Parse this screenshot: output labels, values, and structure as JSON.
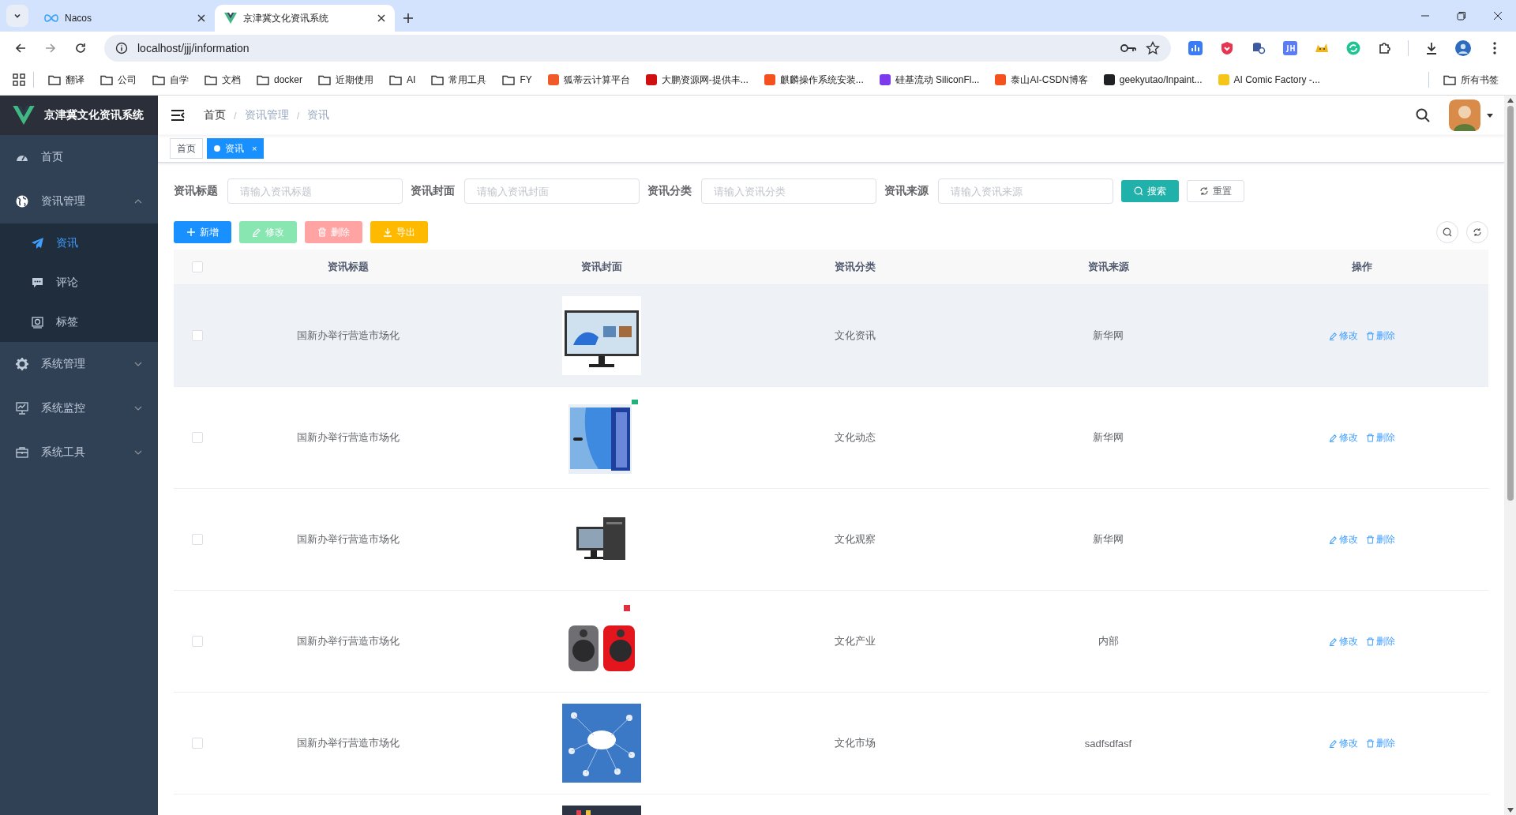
{
  "browser": {
    "tabs": [
      {
        "title": "Nacos",
        "selected": false
      },
      {
        "title": "京津冀文化资讯系统",
        "selected": true
      }
    ],
    "address": "localhost/jjj/information",
    "bookmarks": [
      {
        "label": "翻译",
        "kind": "folder"
      },
      {
        "label": "公司",
        "kind": "folder"
      },
      {
        "label": "自学",
        "kind": "folder"
      },
      {
        "label": "文档",
        "kind": "folder"
      },
      {
        "label": "docker",
        "kind": "folder"
      },
      {
        "label": "近期使用",
        "kind": "folder"
      },
      {
        "label": "AI",
        "kind": "folder"
      },
      {
        "label": "常用工具",
        "kind": "folder"
      },
      {
        "label": "FY",
        "kind": "folder"
      },
      {
        "label": "狐蒂云计算平台",
        "kind": "site",
        "color": "#f05a28"
      },
      {
        "label": "大鹏资源网-提供丰...",
        "kind": "site",
        "color": "#d01010"
      },
      {
        "label": "麒麟操作系统安装...",
        "kind": "site",
        "color": "#f4511e"
      },
      {
        "label": "硅基流动 SiliconFl...",
        "kind": "site",
        "color": "#7c3aed"
      },
      {
        "label": "泰山AI-CSDN博客",
        "kind": "site",
        "color": "#f4511e"
      },
      {
        "label": "geekyutao/Inpaint...",
        "kind": "site",
        "color": "#202124"
      },
      {
        "label": "AI Comic Factory -...",
        "kind": "site",
        "color": "#f5c518"
      }
    ],
    "all_bookmarks": "所有书签"
  },
  "sidebar": {
    "title": "京津冀文化资讯系统",
    "items": [
      {
        "label": "首页",
        "selected": false
      },
      {
        "label": "资讯管理",
        "selected": false,
        "expanded": true,
        "children": [
          {
            "label": "资讯",
            "selected": true
          },
          {
            "label": "评论",
            "selected": false
          },
          {
            "label": "标签",
            "selected": false
          }
        ]
      },
      {
        "label": "系统管理",
        "selected": false,
        "expanded": false
      },
      {
        "label": "系统监控",
        "selected": false,
        "expanded": false
      },
      {
        "label": "系统工具",
        "selected": false,
        "expanded": false
      }
    ]
  },
  "breadcrumb": [
    {
      "label": "首页"
    },
    {
      "label": "资讯管理",
      "separator": "/"
    },
    {
      "label": "资讯",
      "separator": "/"
    }
  ],
  "tags": [
    {
      "label": "首页",
      "selected": false
    },
    {
      "label": "资讯",
      "selected": true,
      "close": "×"
    }
  ],
  "filters": [
    {
      "label": "资讯标题",
      "placeholder": "请输入资讯标题"
    },
    {
      "label": "资讯封面",
      "placeholder": "请输入资讯封面"
    },
    {
      "label": "资讯分类",
      "placeholder": "请输入资讯分类"
    },
    {
      "label": "资讯来源",
      "placeholder": "请输入资讯来源"
    }
  ],
  "search_button": "搜索",
  "reset_button": "重置",
  "toolbar": [
    {
      "label": "新增",
      "kind": "add",
      "disabled": false
    },
    {
      "label": "修改",
      "kind": "edit",
      "disabled": true
    },
    {
      "label": "删除",
      "kind": "delete",
      "disabled": true
    },
    {
      "label": "导出",
      "kind": "export",
      "disabled": false
    }
  ],
  "table": {
    "header_checked": false,
    "columns": [
      "资讯标题",
      "资讯封面",
      "资讯分类",
      "资讯来源",
      "操作"
    ],
    "rows": [
      {
        "checked": false,
        "highlighted": true,
        "title": "国新办举行营造市场化",
        "cover": {
          "kind": "picture"
        },
        "category": "文化资讯",
        "source": "新华网",
        "actions": [
          "修改",
          "删除"
        ]
      },
      {
        "checked": false,
        "highlighted": false,
        "title": "国新办举行营造市场化",
        "cover": {
          "kind": "picture"
        },
        "category": "文化动态",
        "source": "新华网",
        "actions": [
          "修改",
          "删除"
        ]
      },
      {
        "checked": false,
        "highlighted": false,
        "title": "国新办举行营造市场化",
        "cover": {
          "kind": "picture"
        },
        "category": "文化观察",
        "source": "新华网",
        "actions": [
          "修改",
          "删除"
        ]
      },
      {
        "checked": false,
        "highlighted": false,
        "title": "国新办举行营造市场化",
        "cover": {
          "kind": "picture"
        },
        "category": "文化产业",
        "source": "内部",
        "actions": [
          "修改",
          "删除"
        ]
      },
      {
        "checked": false,
        "highlighted": false,
        "title": "国新办举行营造市场化",
        "cover": {
          "kind": "picture"
        },
        "category": "文化市场",
        "source": "sadfsdfasf",
        "actions": [
          "修改",
          "删除"
        ]
      },
      {
        "cover": {
          "kind": "picture"
        }
      }
    ]
  }
}
